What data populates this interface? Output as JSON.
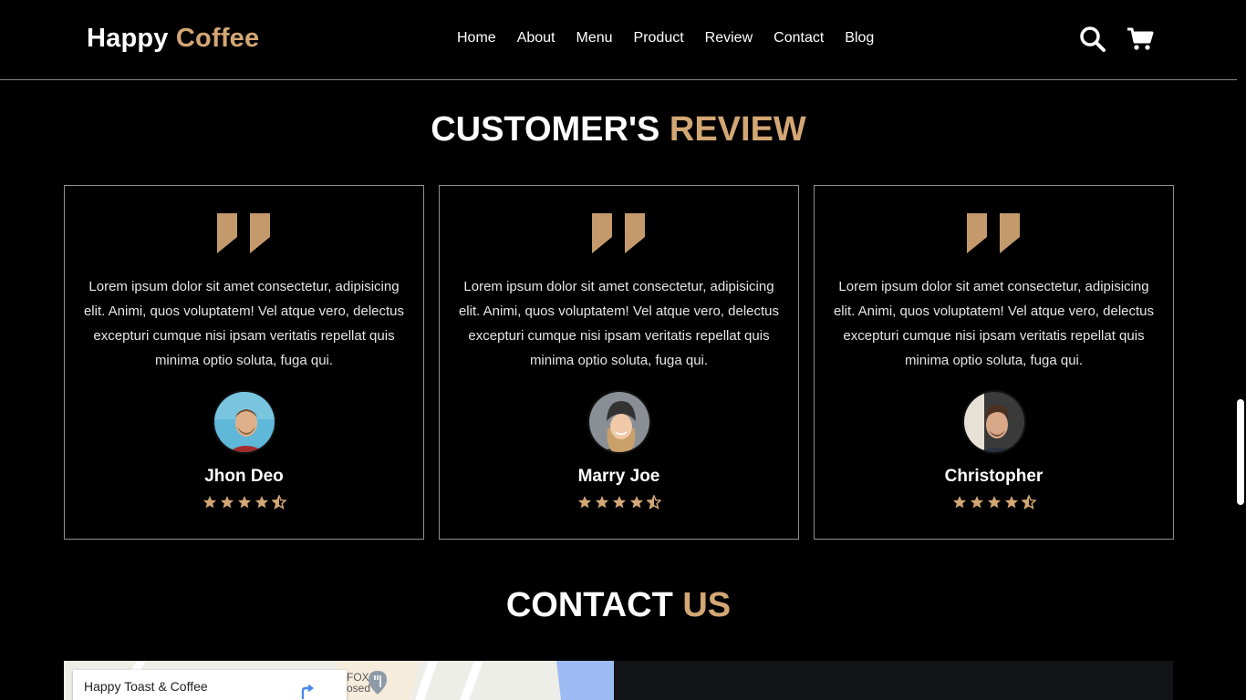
{
  "logo": {
    "primary": "Happy",
    "accent": "Coffee"
  },
  "nav": [
    "Home",
    "About",
    "Menu",
    "Product",
    "Review",
    "Contact",
    "Blog"
  ],
  "icons": {
    "search": "search-icon",
    "cart": "cart-icon"
  },
  "reviews_section": {
    "title_primary": "CUSTOMER'S",
    "title_accent": "REVIEW"
  },
  "reviews": [
    {
      "text": "Lorem ipsum dolor sit amet consectetur, adipisicing elit. Animi, quos voluptatem! Vel atque vero, delectus excepturi cumque nisi ipsam veritatis repellat quis minima optio soluta, fuga qui.",
      "name": "Jhon Deo",
      "rating": 4.5
    },
    {
      "text": "Lorem ipsum dolor sit amet consectetur, adipisicing elit. Animi, quos voluptatem! Vel atque vero, delectus excepturi cumque nisi ipsam veritatis repellat quis minima optio soluta, fuga qui.",
      "name": "Marry Joe",
      "rating": 4.5
    },
    {
      "text": "Lorem ipsum dolor sit amet consectetur, adipisicing elit. Animi, quos voluptatem! Vel atque vero, delectus excepturi cumque nisi ipsam veritatis repellat quis minima optio soluta, fuga qui.",
      "name": "Christopher",
      "rating": 4.5
    }
  ],
  "contact_section": {
    "title_primary": "CONTACT",
    "title_accent": "US"
  },
  "map": {
    "place_name": "Happy Toast & Coffee",
    "label": "FOX\nosed"
  },
  "colors": {
    "accent": "#d3a774",
    "background": "#000000",
    "border": "#8f8f8f"
  }
}
